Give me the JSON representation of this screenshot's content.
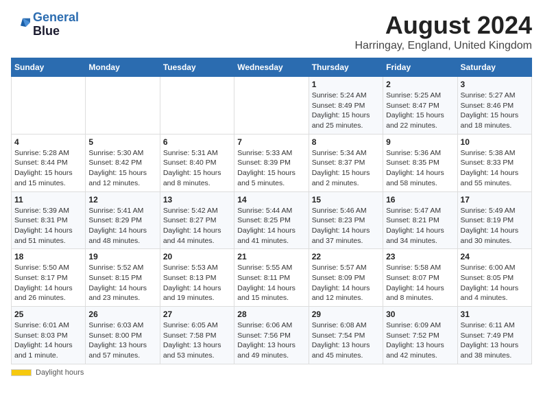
{
  "logo": {
    "line1": "General",
    "line2": "Blue"
  },
  "title": "August 2024",
  "subtitle": "Harringay, England, United Kingdom",
  "days_of_week": [
    "Sunday",
    "Monday",
    "Tuesday",
    "Wednesday",
    "Thursday",
    "Friday",
    "Saturday"
  ],
  "weeks": [
    [
      {
        "num": "",
        "info": ""
      },
      {
        "num": "",
        "info": ""
      },
      {
        "num": "",
        "info": ""
      },
      {
        "num": "",
        "info": ""
      },
      {
        "num": "1",
        "info": "Sunrise: 5:24 AM\nSunset: 8:49 PM\nDaylight: 15 hours and 25 minutes."
      },
      {
        "num": "2",
        "info": "Sunrise: 5:25 AM\nSunset: 8:47 PM\nDaylight: 15 hours and 22 minutes."
      },
      {
        "num": "3",
        "info": "Sunrise: 5:27 AM\nSunset: 8:46 PM\nDaylight: 15 hours and 18 minutes."
      }
    ],
    [
      {
        "num": "4",
        "info": "Sunrise: 5:28 AM\nSunset: 8:44 PM\nDaylight: 15 hours and 15 minutes."
      },
      {
        "num": "5",
        "info": "Sunrise: 5:30 AM\nSunset: 8:42 PM\nDaylight: 15 hours and 12 minutes."
      },
      {
        "num": "6",
        "info": "Sunrise: 5:31 AM\nSunset: 8:40 PM\nDaylight: 15 hours and 8 minutes."
      },
      {
        "num": "7",
        "info": "Sunrise: 5:33 AM\nSunset: 8:39 PM\nDaylight: 15 hours and 5 minutes."
      },
      {
        "num": "8",
        "info": "Sunrise: 5:34 AM\nSunset: 8:37 PM\nDaylight: 15 hours and 2 minutes."
      },
      {
        "num": "9",
        "info": "Sunrise: 5:36 AM\nSunset: 8:35 PM\nDaylight: 14 hours and 58 minutes."
      },
      {
        "num": "10",
        "info": "Sunrise: 5:38 AM\nSunset: 8:33 PM\nDaylight: 14 hours and 55 minutes."
      }
    ],
    [
      {
        "num": "11",
        "info": "Sunrise: 5:39 AM\nSunset: 8:31 PM\nDaylight: 14 hours and 51 minutes."
      },
      {
        "num": "12",
        "info": "Sunrise: 5:41 AM\nSunset: 8:29 PM\nDaylight: 14 hours and 48 minutes."
      },
      {
        "num": "13",
        "info": "Sunrise: 5:42 AM\nSunset: 8:27 PM\nDaylight: 14 hours and 44 minutes."
      },
      {
        "num": "14",
        "info": "Sunrise: 5:44 AM\nSunset: 8:25 PM\nDaylight: 14 hours and 41 minutes."
      },
      {
        "num": "15",
        "info": "Sunrise: 5:46 AM\nSunset: 8:23 PM\nDaylight: 14 hours and 37 minutes."
      },
      {
        "num": "16",
        "info": "Sunrise: 5:47 AM\nSunset: 8:21 PM\nDaylight: 14 hours and 34 minutes."
      },
      {
        "num": "17",
        "info": "Sunrise: 5:49 AM\nSunset: 8:19 PM\nDaylight: 14 hours and 30 minutes."
      }
    ],
    [
      {
        "num": "18",
        "info": "Sunrise: 5:50 AM\nSunset: 8:17 PM\nDaylight: 14 hours and 26 minutes."
      },
      {
        "num": "19",
        "info": "Sunrise: 5:52 AM\nSunset: 8:15 PM\nDaylight: 14 hours and 23 minutes."
      },
      {
        "num": "20",
        "info": "Sunrise: 5:53 AM\nSunset: 8:13 PM\nDaylight: 14 hours and 19 minutes."
      },
      {
        "num": "21",
        "info": "Sunrise: 5:55 AM\nSunset: 8:11 PM\nDaylight: 14 hours and 15 minutes."
      },
      {
        "num": "22",
        "info": "Sunrise: 5:57 AM\nSunset: 8:09 PM\nDaylight: 14 hours and 12 minutes."
      },
      {
        "num": "23",
        "info": "Sunrise: 5:58 AM\nSunset: 8:07 PM\nDaylight: 14 hours and 8 minutes."
      },
      {
        "num": "24",
        "info": "Sunrise: 6:00 AM\nSunset: 8:05 PM\nDaylight: 14 hours and 4 minutes."
      }
    ],
    [
      {
        "num": "25",
        "info": "Sunrise: 6:01 AM\nSunset: 8:03 PM\nDaylight: 14 hours and 1 minute."
      },
      {
        "num": "26",
        "info": "Sunrise: 6:03 AM\nSunset: 8:00 PM\nDaylight: 13 hours and 57 minutes."
      },
      {
        "num": "27",
        "info": "Sunrise: 6:05 AM\nSunset: 7:58 PM\nDaylight: 13 hours and 53 minutes."
      },
      {
        "num": "28",
        "info": "Sunrise: 6:06 AM\nSunset: 7:56 PM\nDaylight: 13 hours and 49 minutes."
      },
      {
        "num": "29",
        "info": "Sunrise: 6:08 AM\nSunset: 7:54 PM\nDaylight: 13 hours and 45 minutes."
      },
      {
        "num": "30",
        "info": "Sunrise: 6:09 AM\nSunset: 7:52 PM\nDaylight: 13 hours and 42 minutes."
      },
      {
        "num": "31",
        "info": "Sunrise: 6:11 AM\nSunset: 7:49 PM\nDaylight: 13 hours and 38 minutes."
      }
    ]
  ],
  "footer": {
    "daylight_label": "Daylight hours"
  }
}
